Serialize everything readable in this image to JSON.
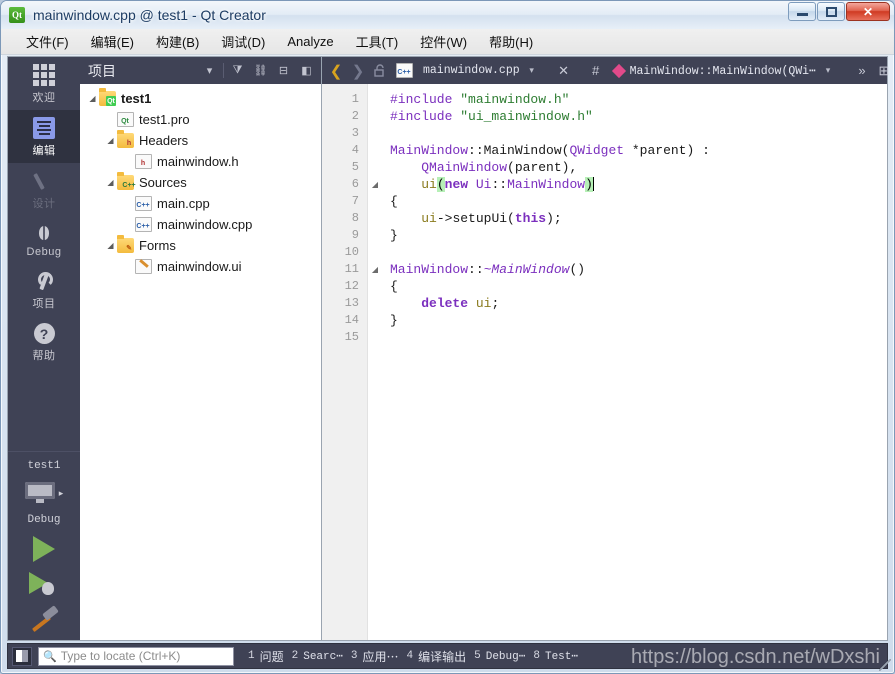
{
  "window": {
    "title": "mainwindow.cpp @ test1 - Qt Creator",
    "logo_text": "Qt",
    "minimize_label": "Minimize",
    "maximize_label": "Maximize",
    "close_label": "✕"
  },
  "menubar": {
    "items": [
      {
        "label": "文件(F)",
        "name": "menu-file"
      },
      {
        "label": "编辑(E)",
        "name": "menu-edit"
      },
      {
        "label": "构建(B)",
        "name": "menu-build"
      },
      {
        "label": "调试(D)",
        "name": "menu-debug"
      },
      {
        "label": "Analyze",
        "name": "menu-analyze"
      },
      {
        "label": "工具(T)",
        "name": "menu-tools"
      },
      {
        "label": "控件(W)",
        "name": "menu-window"
      },
      {
        "label": "帮助(H)",
        "name": "menu-help"
      }
    ]
  },
  "modebar": {
    "modes": [
      {
        "label": "欢迎",
        "icon": "grid-icon",
        "state": "normal"
      },
      {
        "label": "编辑",
        "icon": "document-lines-icon",
        "state": "active"
      },
      {
        "label": "设计",
        "icon": "pencil-icon",
        "state": "disabled"
      },
      {
        "label": "Debug",
        "icon": "bug-icon",
        "state": "normal"
      },
      {
        "label": "项目",
        "icon": "wrench-icon",
        "state": "normal"
      },
      {
        "label": "帮助",
        "icon": "question-circle-icon",
        "state": "normal"
      }
    ],
    "kit_name": "test1",
    "kit_mode": "Debug",
    "kit_arrow": "▸",
    "run_label": "Run",
    "debug_label": "Start Debugging",
    "build_label": "Build"
  },
  "project_pane": {
    "title": "项目",
    "buttons": [
      {
        "name": "filter-dropdown-caret",
        "glyph": "▾"
      },
      {
        "name": "filter-icon",
        "glyph": "⧩"
      },
      {
        "name": "link-with-editor-icon",
        "glyph": "⛓"
      },
      {
        "name": "split-icon",
        "glyph": "⊞"
      },
      {
        "name": "close-sidebar-icon",
        "glyph": "◧"
      }
    ],
    "tree": [
      {
        "label": "test1",
        "indent": 0,
        "arrow": "▾",
        "icon": "qt-project-folder-icon",
        "bold": true
      },
      {
        "label": "test1.pro",
        "indent": 1,
        "arrow": "",
        "icon": "qt-pro-file-icon",
        "bold": false
      },
      {
        "label": "Headers",
        "indent": 1,
        "arrow": "▾",
        "icon": "headers-folder-icon",
        "bold": false
      },
      {
        "label": "mainwindow.h",
        "indent": 2,
        "arrow": "",
        "icon": "h-file-icon",
        "bold": false
      },
      {
        "label": "Sources",
        "indent": 1,
        "arrow": "▾",
        "icon": "sources-folder-icon",
        "bold": false
      },
      {
        "label": "main.cpp",
        "indent": 2,
        "arrow": "",
        "icon": "cpp-file-icon",
        "bold": false
      },
      {
        "label": "mainwindow.cpp",
        "indent": 2,
        "arrow": "",
        "icon": "cpp-file-icon",
        "bold": false
      },
      {
        "label": "Forms",
        "indent": 1,
        "arrow": "▾",
        "icon": "forms-folder-icon",
        "bold": false
      },
      {
        "label": "mainwindow.ui",
        "indent": 2,
        "arrow": "",
        "icon": "ui-file-icon",
        "bold": false
      }
    ]
  },
  "editor_toolbar": {
    "back_glyph": "❮",
    "forward_glyph": "❯",
    "lock_glyph": "🔓",
    "filename": "mainwindow.cpp",
    "file_dropdown_caret": "▾",
    "close_glyph": "✕",
    "hash_glyph": "#",
    "symbol": "MainWindow::MainWindow(QWi⋯",
    "symbol_caret": "▾",
    "more_glyph": "»",
    "split_glyph": "⊞"
  },
  "editor": {
    "line_numbers": [
      "1",
      "2",
      "3",
      "4",
      "5",
      "6",
      "7",
      "8",
      "9",
      "10",
      "11",
      "12",
      "13",
      "14",
      "15"
    ],
    "fold_markers": {
      "6": "◢",
      "11": "◢"
    },
    "lines": [
      {
        "n": 1,
        "tokens": [
          {
            "t": "#include ",
            "c": "t-pre"
          },
          {
            "t": "\"mainwindow.h\"",
            "c": "t-str"
          }
        ]
      },
      {
        "n": 2,
        "tokens": [
          {
            "t": "#include ",
            "c": "t-pre"
          },
          {
            "t": "\"ui_mainwindow.h\"",
            "c": "t-str"
          }
        ]
      },
      {
        "n": 3,
        "tokens": []
      },
      {
        "n": 4,
        "tokens": [
          {
            "t": "MainWindow",
            "c": "t-type"
          },
          {
            "t": "::",
            "c": "t-plain"
          },
          {
            "t": "MainWindow",
            "c": "t-plain"
          },
          {
            "t": "(",
            "c": "t-plain"
          },
          {
            "t": "QWidget",
            "c": "t-type"
          },
          {
            "t": " *parent",
            "c": "t-plain"
          },
          {
            "t": ") :",
            "c": "t-plain"
          }
        ]
      },
      {
        "n": 5,
        "tokens": [
          {
            "t": "    ",
            "c": "t-plain"
          },
          {
            "t": "QMainWindow",
            "c": "t-type"
          },
          {
            "t": "(parent),",
            "c": "t-plain"
          }
        ]
      },
      {
        "n": 6,
        "tokens": [
          {
            "t": "    ",
            "c": "t-plain"
          },
          {
            "t": "ui",
            "c": "t-var"
          },
          {
            "t": "(",
            "c": "brace-hl"
          },
          {
            "t": "new ",
            "c": "t-kw"
          },
          {
            "t": "Ui",
            "c": "t-type"
          },
          {
            "t": "::",
            "c": "t-plain"
          },
          {
            "t": "MainWindow",
            "c": "t-type"
          },
          {
            "t": ")",
            "c": "brace-hl"
          }
        ],
        "cursor": true
      },
      {
        "n": 7,
        "tokens": [
          {
            "t": "{",
            "c": "t-plain"
          }
        ]
      },
      {
        "n": 8,
        "tokens": [
          {
            "t": "    ",
            "c": "t-plain"
          },
          {
            "t": "ui",
            "c": "t-var"
          },
          {
            "t": "->",
            "c": "t-plain"
          },
          {
            "t": "setupUi",
            "c": "t-plain"
          },
          {
            "t": "(",
            "c": "t-plain"
          },
          {
            "t": "this",
            "c": "t-kw"
          },
          {
            "t": ");",
            "c": "t-plain"
          }
        ]
      },
      {
        "n": 9,
        "tokens": [
          {
            "t": "}",
            "c": "t-plain"
          }
        ]
      },
      {
        "n": 10,
        "tokens": []
      },
      {
        "n": 11,
        "tokens": [
          {
            "t": "MainWindow",
            "c": "t-type"
          },
          {
            "t": "::",
            "c": "t-plain"
          },
          {
            "t": "~MainWindow",
            "c": "t-ital"
          },
          {
            "t": "()",
            "c": "t-plain"
          }
        ]
      },
      {
        "n": 12,
        "tokens": [
          {
            "t": "{",
            "c": "t-plain"
          }
        ]
      },
      {
        "n": 13,
        "tokens": [
          {
            "t": "    ",
            "c": "t-plain"
          },
          {
            "t": "delete",
            "c": "t-kw"
          },
          {
            "t": " ",
            "c": "t-plain"
          },
          {
            "t": "ui",
            "c": "t-var"
          },
          {
            "t": ";",
            "c": "t-plain"
          }
        ]
      },
      {
        "n": 14,
        "tokens": [
          {
            "t": "}",
            "c": "t-plain"
          }
        ]
      },
      {
        "n": 15,
        "tokens": []
      }
    ]
  },
  "statusbar": {
    "sidebar_toggle_name": "toggle-sidebar-button",
    "locator_placeholder": "Type to locate (Ctrl+K)",
    "locator_value": "",
    "output_panes": [
      {
        "num": "1",
        "label": "问题",
        "mono": false
      },
      {
        "num": "2",
        "label": "Searc⋯",
        "mono": true
      },
      {
        "num": "3",
        "label": "应用⋯",
        "mono": false
      },
      {
        "num": "4",
        "label": "编译输出",
        "mono": false
      },
      {
        "num": "5",
        "label": "Debug⋯",
        "mono": true
      },
      {
        "num": "8",
        "label": "Test⋯",
        "mono": true
      }
    ]
  },
  "watermark": "https://blog.csdn.net/wDxshi"
}
